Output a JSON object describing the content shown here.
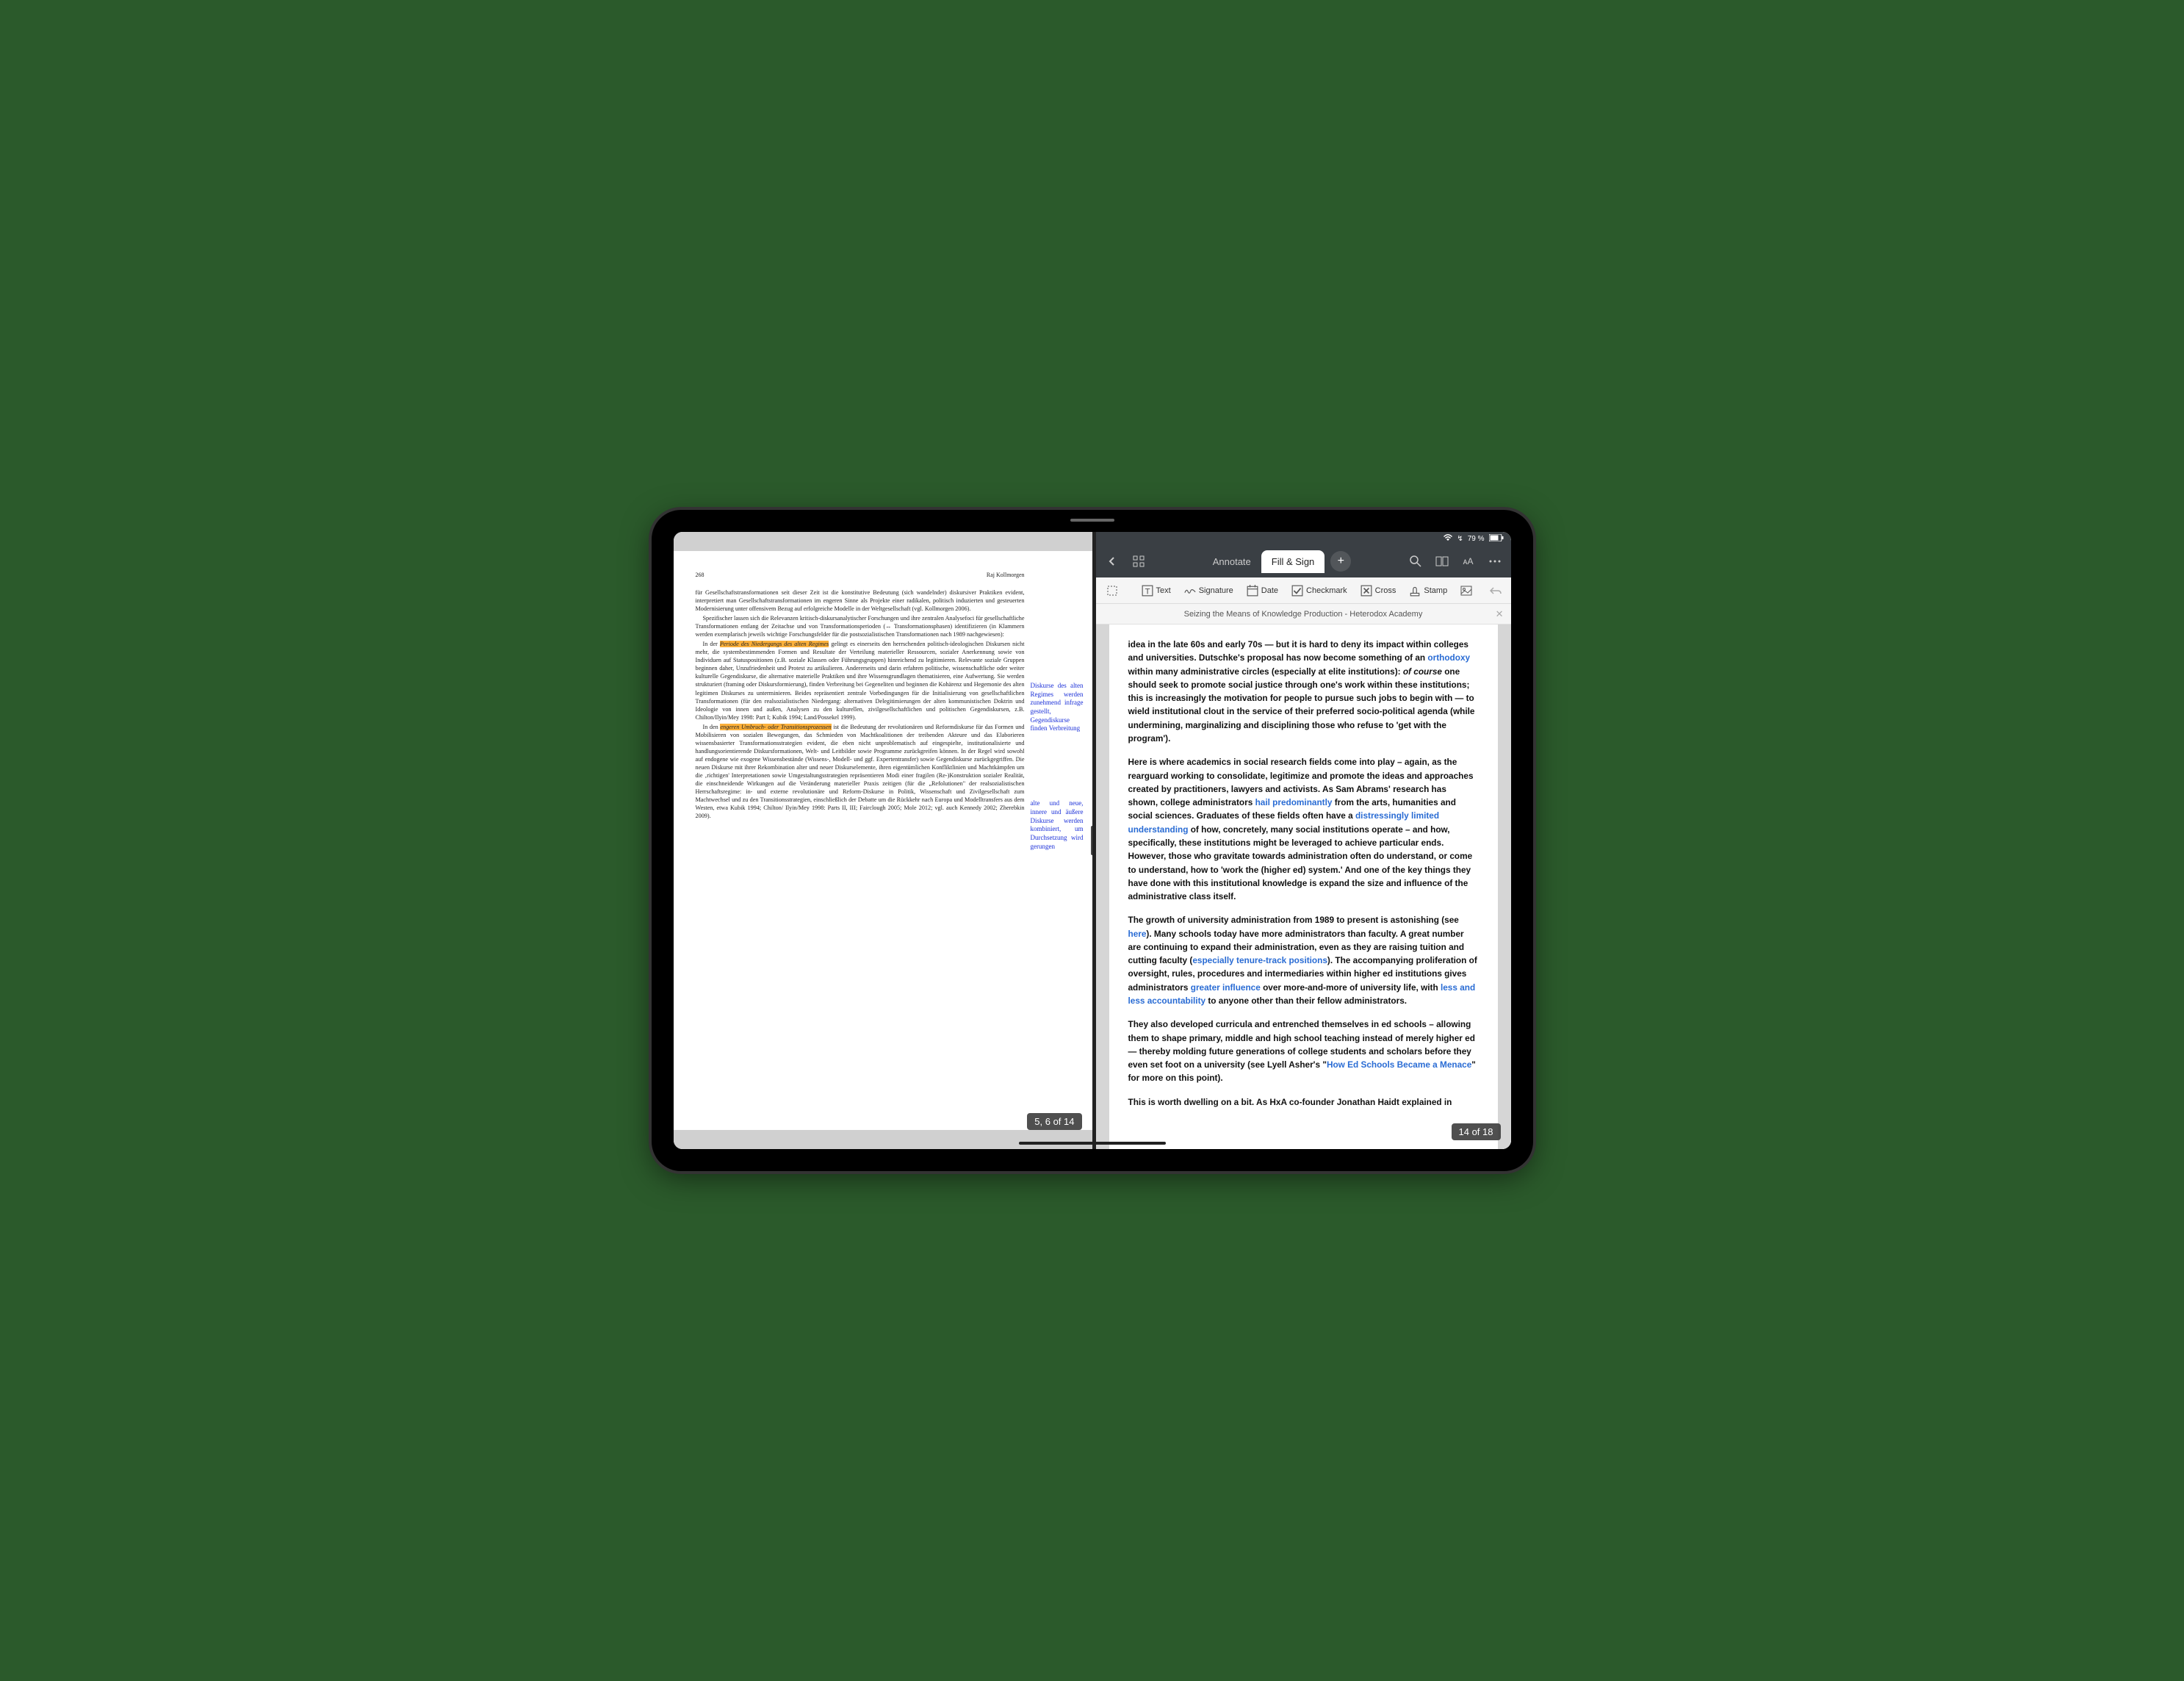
{
  "status": {
    "wifi": "wifi-icon",
    "battery_text": "79 %",
    "charging": true
  },
  "left": {
    "page_number": "268",
    "author": "Raj Kollmorgen",
    "page_counter": "5, 6 of 14",
    "paragraphs": {
      "p1": "für Gesellschaftstransformationen seit dieser Zeit ist die konstitutive Bedeutung (sich wandelnder) diskursiver Praktiken evident, interpretiert man Gesellschaftstransformationen im engeren Sinne als Projekte einer radikalen, politisch induzierten und gesteuerten Modernisierung unter offensivem Bezug auf erfolgreiche Modelle in der Weltgesellschaft (vgl. Kollmorgen 2006).",
      "p2": "Spezifischer lassen sich die Relevanzen kritisch-diskursanalytischer Forschungen und ihre zentralen Analysefoci für gesellschaftliche Transformationen entlang der Zeitachse und von Transformationsperioden (↔ Transformationsphasen) identifizieren (in Klammern werden exemplarisch jeweils wichtige Forschungsfelder für die postsozialistischen Transformationen nach 1989 nachgewiesen):",
      "p3a": "In der ",
      "p3_hl": "Periode des Niedergangs des alten Regimes",
      "p3b": " gelingt es einerseits den herrschenden politisch-ideologischen Diskursen nicht mehr, die systembestimmenden Formen und Resultate der Verteilung materieller Ressourcen, sozialer Anerkennung sowie von Individuen auf Statuspositionen (z.B. soziale Klassen oder Führungsgruppen) hinreichend zu legitimieren. Relevante soziale Gruppen beginnen daher, Unzufriedenheit und Protest zu artikulieren. Andererseits und darin erfahren politische, wissenschaftliche oder weiter kulturelle Gegendiskurse, die alternative materielle Praktiken und ihre Wissensgrundlagen thematisieren, eine Aufwertung. Sie werden strukturiert (framing oder Diskursformierung), finden Verbreitung bei Gegeneliten und beginnen die Kohärenz und Hegemonie des alten legitimen Diskurses zu unterminieren. Beides repräsentiert zentrale Vorbedingungen für die Initialisierung von gesellschaftlichen Transformationen (für den realsozialistischen Niedergang: alternativen Delegitimierungen der alten kommunistischen Doktrin und Ideologie von innen und außen, Analysen zu den kulturellen, zivilgesellschaftlichen und politischen Gegendiskursen, z.B. Chilton/Ilyin/Mey 1998: Part I; Kubik 1994; Land/Possekel 1999).",
      "p4a": "In den ",
      "p4_hl": "engeren Umbruch- oder Transitionsprozessen",
      "p4b": " ist die Bedeutung der revolutionären und Reformdiskurse für das Formen und Mobilisieren von sozialen Bewegungen, das Schmieden von Machtkoalitionen der treibenden Akteure und das Elaborieren wissensbasierter Transformationsstrategien evident, die eben nicht unproblematisch auf eingespielte, institutionalisierte und handlungsorientierende Diskursformationen, Welt- und Leitbilder sowie Programme zurückgreifen können. In der Regel wird sowohl auf endogene wie exogene Wissensbestände (Wissens-, Modell- und ggf. Expertentransfer) sowie Gegendiskurse zurückgegriffen. Die neuen Diskurse mit ihrer Rekombination alter und neuer Diskurselemente, ihren eigentümlichen Konfliktlinien und Machtkämpfen um die ‚richtigen' Interpretationen sowie Umgestaltungsstrategien repräsentieren Modi einer fragilen (Re-)Konstruktion sozialer Realität, die einschneidende Wirkungen auf die Veränderung materieller Praxis zeitigen (für die „Refolutionen\" der realsozialistischen Herrschaftsregime: in- und externe revolutionäre und Reform-Diskurse in Politik, Wissenschaft und Zivilgesellschaft zum Machtwechsel und zu den Transitionsstrategien, einschließlich der Debatte um die Rückkehr nach Europa und Modelltransfers aus dem Westen, etwa Kubik 1994; Chilton/ Ilyin/Mey 1998: Parts II, III; Fairclough 2005; Mole 2012; vgl. auch Kennedy 2002; Zherebkin 2009)."
    },
    "annotations": {
      "a1": "Diskurse des alten Regimes werden zunehmend infrage gestellt, Gegendiskurse finden Verbreitung",
      "a2": "alte und neue, innere und äußere Diskurse werden kombiniert, um Durchsetzung wird gerungen"
    }
  },
  "right": {
    "tabs": {
      "annotate": "Annotate",
      "fillsign": "Fill & Sign"
    },
    "sub": {
      "text": "Text",
      "signature": "Signature",
      "date": "Date",
      "checkmark": "Checkmark",
      "cross": "Cross",
      "stamp": "Stamp"
    },
    "doc_title": "Seizing the Means of Knowledge Production - Heterodox Academy",
    "page_counter": "14 of 18",
    "content": {
      "p1a": "idea in the late 60s and early 70s — but it is hard to deny its impact within colleges and universities. Dutschke's proposal has now become something of an ",
      "p1_link1": "orthodoxy",
      "p1b": " within many administrative circles (especially at elite institutions): ",
      "p1_ital": "of course",
      "p1c": " one should seek to promote social justice through one's work within these institutions; this is increasingly the motivation for people to pursue such jobs to begin with — to wield institutional clout in the service of their preferred socio-political agenda (while undermining, marginalizing and disciplining those who refuse to 'get with the program').",
      "p2a": "Here is where academics in social research fields come into play – again, as the rearguard working to consolidate, legitimize and promote the ideas and approaches created by practitioners, lawyers and activists. As Sam Abrams' research has shown, college administrators ",
      "p2_link1": "hail predominantly",
      "p2b": " from the arts, humanities and social sciences. Graduates of these fields often have a ",
      "p2_link2": "distressingly limited understanding",
      "p2c": " of how, concretely, many social institutions operate – and how, specifically, these institutions might be leveraged to achieve particular ends. However, those who gravitate towards administration often do understand, or come to understand, how to 'work the (higher ed) system.' And one of the key things they have done with this institutional knowledge is expand the size and influence of the administrative class itself.",
      "p3a": "The growth of university administration from 1989 to present is astonishing (see ",
      "p3_link1": "here",
      "p3b": "). Many schools today have more administrators than faculty. A great number are continuing to expand their administration, even as they are raising tuition and cutting faculty (",
      "p3_link2": "especially tenure-track positions",
      "p3c": "). The accompanying proliferation of oversight, rules, procedures and intermediaries within higher ed institutions gives administrators ",
      "p3_link3": "greater influence",
      "p3d": " over more-and-more of university life, with ",
      "p3_link4": "less and less accountability",
      "p3e": " to anyone other than their fellow administrators.",
      "p4a": "They also developed curricula and entrenched themselves in ed schools – allowing them to shape primary, middle and high school teaching instead of merely higher ed — thereby molding future generations of college students and scholars before they even set foot on a university (see Lyell Asher's \"",
      "p4_link1": "How Ed Schools Became a Menace",
      "p4b": "\" for more on this point).",
      "p5": "This is worth dwelling on a bit. As HxA co-founder Jonathan Haidt explained in"
    }
  }
}
